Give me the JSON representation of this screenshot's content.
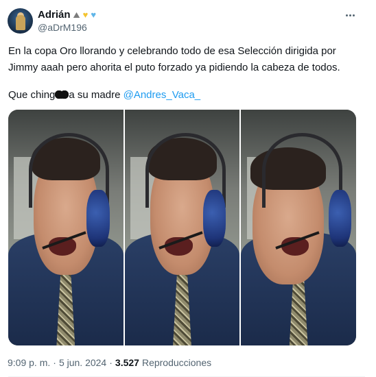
{
  "author": {
    "display_name": "Adrián",
    "handle": "@aDrM196",
    "emojis": [
      {
        "name": "mountain-emoji",
        "glyph": "⛰"
      },
      {
        "name": "yellow-heart-emoji",
        "glyph": "♥"
      },
      {
        "name": "blue-heart-emoji",
        "glyph": "♥"
      }
    ]
  },
  "tweet": {
    "line1": "En la copa Oro llorando y celebrando todo de esa Selección dirigida por Jimmy aaah pero ahorita el puto forzado ya pidiendo la cabeza de todos.",
    "line2_before": "Que ching",
    "line2_after": "a su madre ",
    "mention": "@Andres_Vaca_"
  },
  "media": {
    "frames": [
      "frame-1",
      "frame-2",
      "frame-3"
    ]
  },
  "footer": {
    "time": "9:09 p. m.",
    "separator": "·",
    "date": "5 jun. 2024",
    "views_count": "3.527",
    "views_label": "Reproducciones"
  },
  "colors": {
    "text": "#0f1419",
    "secondary": "#536471",
    "link": "#1d9bf0"
  }
}
